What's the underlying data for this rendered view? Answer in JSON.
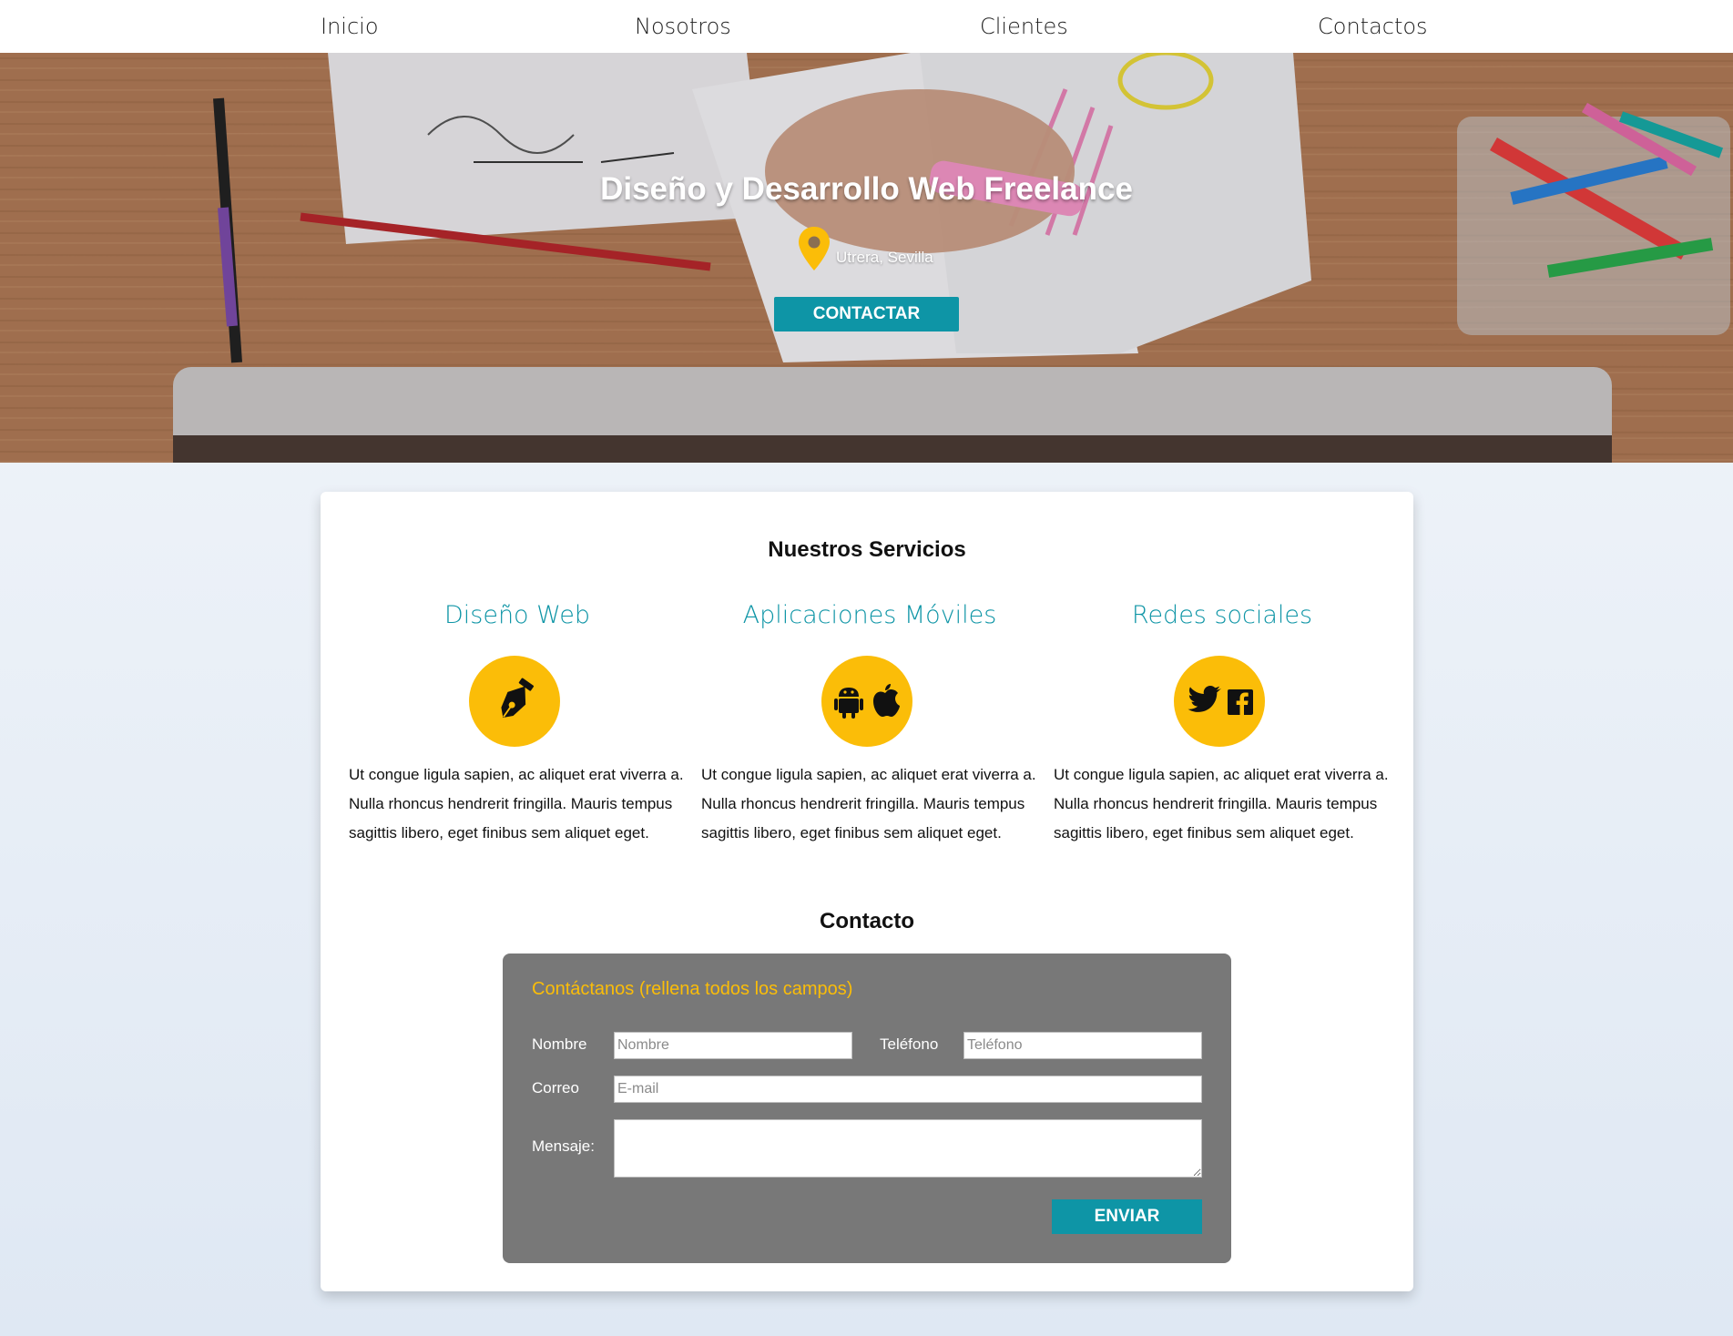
{
  "nav": {
    "items": [
      {
        "label": "Inicio"
      },
      {
        "label": "Nosotros"
      },
      {
        "label": "Clientes"
      },
      {
        "label": "Contactos"
      }
    ]
  },
  "hero": {
    "title": "Diseño y Desarrollo Web Freelance",
    "location": "Utrera, Sevilla",
    "button_label": "CONTACTAR"
  },
  "services": {
    "title": "Nuestros Servicios",
    "items": [
      {
        "title": "Diseño Web",
        "icons": [
          "pen-nib-icon"
        ],
        "text": "Ut congue ligula sapien, ac aliquet erat viverra a. Nulla rhoncus hendrerit fringilla. Mauris tempus sagittis libero, eget finibus sem aliquet eget."
      },
      {
        "title": "Aplicaciones Móviles",
        "icons": [
          "android-icon",
          "apple-icon"
        ],
        "text": "Ut congue ligula sapien, ac aliquet erat viverra a. Nulla rhoncus hendrerit fringilla. Mauris tempus sagittis libero, eget finibus sem aliquet eget."
      },
      {
        "title": "Redes sociales",
        "icons": [
          "twitter-icon",
          "facebook-icon"
        ],
        "text": "Ut congue ligula sapien, ac aliquet erat viverra a. Nulla rhoncus hendrerit fringilla. Mauris tempus sagittis libero, eget finibus sem aliquet eget."
      }
    ]
  },
  "contact": {
    "title": "Contacto",
    "form_title": "Contáctanos (rellena todos los campos)",
    "name_label": "Nombre",
    "name_placeholder": "Nombre",
    "phone_label": "Teléfono",
    "phone_placeholder": "Teléfono",
    "email_label": "Correo",
    "email_placeholder": "E-mail",
    "message_label": "Mensaje:",
    "send_label": "ENVIAR"
  },
  "colors": {
    "accent": "#0e95a6",
    "icon_circle": "#fbbd08",
    "form_bg": "#787878",
    "form_title": "#fbbd08"
  }
}
